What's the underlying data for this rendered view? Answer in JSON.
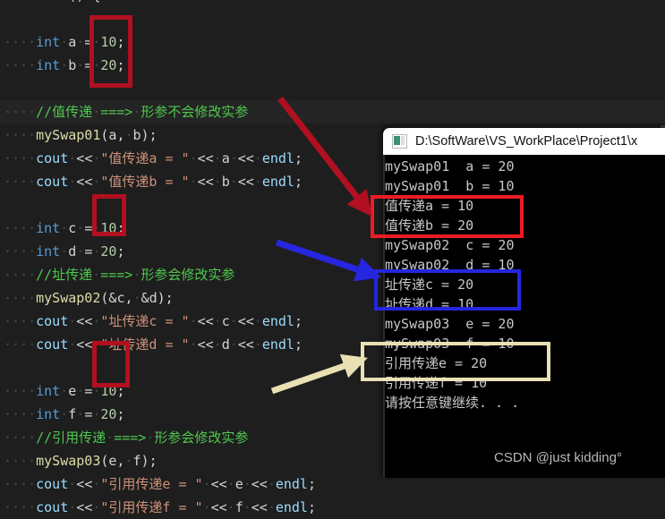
{
  "editor": {
    "name": "vs-code-editor",
    "background": "#1e1e1e",
    "lines": [
      {
        "indent": 0,
        "highlight": false,
        "text": "int main() {",
        "cut_top": true
      },
      {
        "indent": 0,
        "highlight": false,
        "text": ""
      },
      {
        "indent": 1,
        "highlight": false,
        "text": "int a = 10;"
      },
      {
        "indent": 1,
        "highlight": false,
        "text": "int b = 20;"
      },
      {
        "indent": 0,
        "highlight": false,
        "text": ""
      },
      {
        "indent": 1,
        "highlight": true,
        "text": "//值传递 ===> 形参不会修改实参"
      },
      {
        "indent": 1,
        "highlight": false,
        "text": "mySwap01(a, b);"
      },
      {
        "indent": 1,
        "highlight": false,
        "text": "cout << \"值传递a = \" << a << endl;"
      },
      {
        "indent": 1,
        "highlight": false,
        "text": "cout << \"值传递b = \" << b << endl;"
      },
      {
        "indent": 0,
        "highlight": false,
        "text": ""
      },
      {
        "indent": 1,
        "highlight": false,
        "text": "int c = 10;"
      },
      {
        "indent": 1,
        "highlight": false,
        "text": "int d = 20;"
      },
      {
        "indent": 1,
        "highlight": false,
        "text": "//址传递 ===> 形参会修改实参"
      },
      {
        "indent": 1,
        "highlight": false,
        "text": "mySwap02(&c, &d);"
      },
      {
        "indent": 1,
        "highlight": false,
        "text": "cout << \"址传递c = \" << c << endl;"
      },
      {
        "indent": 1,
        "highlight": false,
        "text": "cout << \"址传递d = \" << d << endl;"
      },
      {
        "indent": 0,
        "highlight": false,
        "text": ""
      },
      {
        "indent": 1,
        "highlight": false,
        "text": "int e = 10;"
      },
      {
        "indent": 1,
        "highlight": false,
        "text": "int f = 20;"
      },
      {
        "indent": 1,
        "highlight": false,
        "text": "//引用传递 ===> 形参会修改实参"
      },
      {
        "indent": 1,
        "highlight": false,
        "text": "mySwap03(e, f);"
      },
      {
        "indent": 1,
        "highlight": false,
        "text": "cout << \"引用传递e = \" << e << endl;"
      },
      {
        "indent": 1,
        "highlight": false,
        "text": "cout << \"引用传递f = \" << f << endl;"
      }
    ]
  },
  "console": {
    "name": "console-output-window",
    "title": "D:\\SoftWare\\VS_WorkPlace\\Project1\\x",
    "icon": "console-app-icon",
    "lines": [
      "mySwap01  a = 20",
      "mySwap01  b = 10",
      "值传递a = 10",
      "值传递b = 20",
      "mySwap02  c = 20",
      "mySwap02  d = 10",
      "址传递c = 20",
      "址传递d = 10",
      "mySwap03  e = 20",
      "mySwap03  f = 10",
      "引用传递e = 20",
      "引用传递f = 10",
      "请按任意键继续. . ."
    ]
  },
  "annotations": {
    "colors": {
      "red_dark": "#b01020",
      "red_bright": "#ec1c24",
      "blue": "#2626e0",
      "tan": "#e9e0b4"
    },
    "boxes": [
      {
        "name": "code-box-ab",
        "color": "#b01020"
      },
      {
        "name": "code-box-cd",
        "color": "#b01020"
      },
      {
        "name": "code-box-ef",
        "color": "#b01020"
      },
      {
        "name": "console-box-value",
        "color": "#ec1c24"
      },
      {
        "name": "console-box-addr",
        "color": "#2626e0"
      },
      {
        "name": "console-box-ref",
        "color": "#e9e0b4"
      }
    ],
    "arrows": [
      {
        "name": "arrow-value-pass",
        "color": "#b01020"
      },
      {
        "name": "arrow-address-pass",
        "color": "#2626e0"
      },
      {
        "name": "arrow-reference-pass",
        "color": "#e9e0b4"
      }
    ]
  },
  "watermark": {
    "text": "CSDN @just kidding°"
  }
}
